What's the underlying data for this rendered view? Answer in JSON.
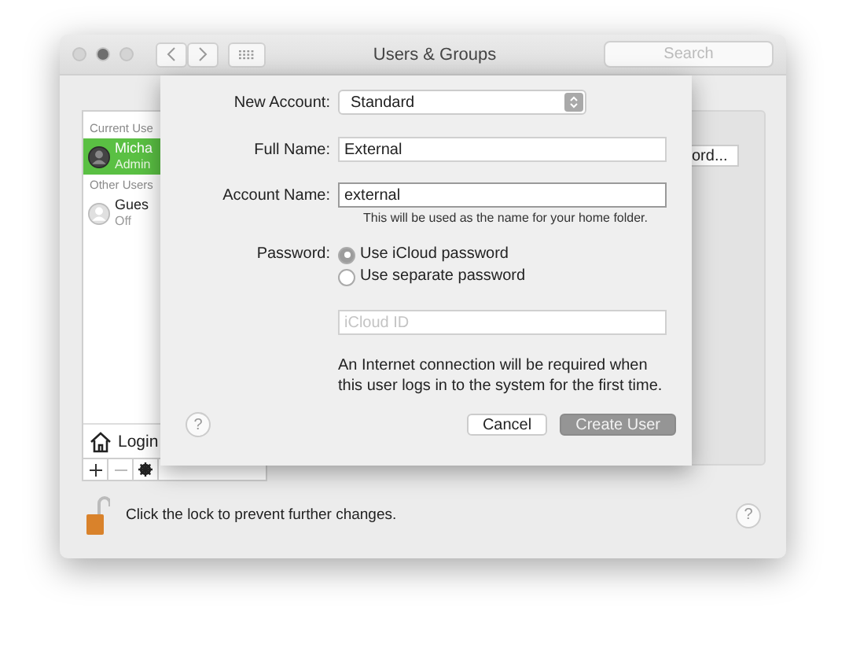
{
  "window": {
    "title": "Users & Groups",
    "search": {
      "placeholder": "Search"
    }
  },
  "sidebar": {
    "sections": [
      {
        "heading": "Current Use",
        "users": [
          {
            "name": "Micha",
            "role": "Admin",
            "selected": true
          }
        ]
      },
      {
        "heading": "Other Users",
        "users": [
          {
            "name": "Gues",
            "role": "Off",
            "selected": false
          }
        ]
      }
    ],
    "login_options": "Login"
  },
  "right_panel": {
    "button": "ord..."
  },
  "sheet": {
    "new_account": {
      "label": "New Account:",
      "value": "Standard"
    },
    "full_name": {
      "label": "Full Name:",
      "value": "External"
    },
    "account_name": {
      "label": "Account Name:",
      "value": "external",
      "hint": "This will be used as the name for your home folder."
    },
    "password": {
      "label": "Password:",
      "options": [
        {
          "label": "Use iCloud password",
          "selected": true
        },
        {
          "label": "Use separate password",
          "selected": false
        }
      ]
    },
    "icloud_id": {
      "placeholder": "iCloud ID"
    },
    "note": "An Internet connection will be required when this user logs in to the system for the first time.",
    "help": "?",
    "buttons": [
      {
        "label": "Cancel",
        "kind": "cancel",
        "disabled": false
      },
      {
        "label": "Create User",
        "kind": "default",
        "disabled": true
      }
    ]
  },
  "footer": {
    "lock_text": "Click the lock to prevent further changes.",
    "help": "?"
  }
}
